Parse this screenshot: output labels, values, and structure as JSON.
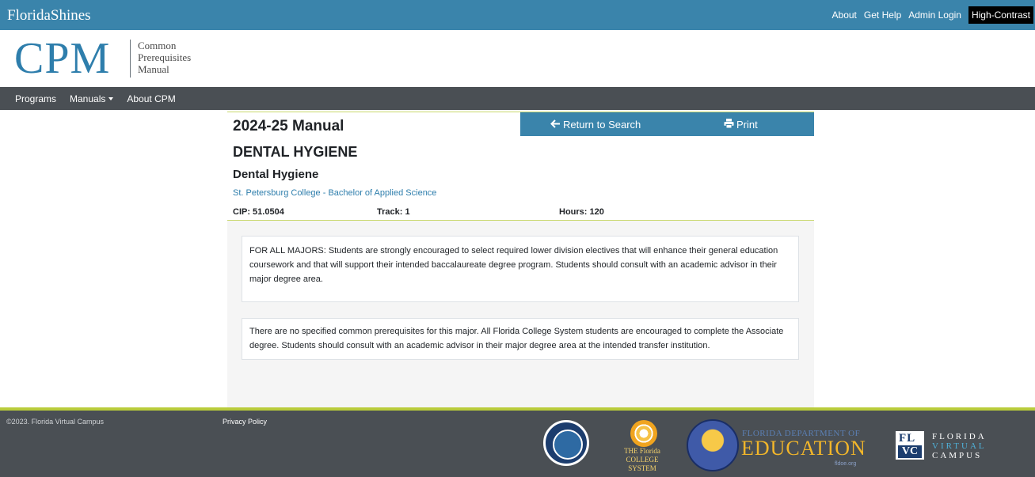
{
  "topbar": {
    "brand": "FloridaShines",
    "links": [
      "About",
      "Get Help",
      "Admin Login"
    ],
    "high_contrast": "High-Contrast"
  },
  "logo": {
    "acronym": "CPM",
    "line1": "Common",
    "line2": "Prerequisites",
    "line3": "Manual"
  },
  "nav": {
    "programs": "Programs",
    "manuals": "Manuals",
    "about": "About CPM"
  },
  "panel": {
    "manual_title": "2024-25 Manual",
    "return_label": "Return to Search",
    "print_label": "Print",
    "program_title": "DENTAL HYGIENE",
    "program_sub": "Dental Hygiene",
    "institution": "St. Petersburg College - Bachelor of Applied Science",
    "cip": "CIP: 51.0504",
    "track": "Track: 1",
    "hours": "Hours: 120",
    "note_majors": "FOR ALL MAJORS: Students are strongly encouraged to select required lower division electives that will enhance their general education coursework and that will support their intended baccalaureate degree program. Students should consult with an academic advisor in their major degree area.",
    "note_prereq": "There are no specified common prerequisites for this major. All Florida College System students are encouraged to complete the Associate degree. Students should consult with an academic advisor in their major degree area at the intended transfer institution."
  },
  "footer": {
    "copyright": "©2023. Florida Virtual Campus",
    "privacy": "Privacy Policy",
    "fcs_line1": "THE Florida",
    "fcs_line2": "COLLEGE SYSTEM",
    "fdoe_top": "FLORIDA DEPARTMENT OF",
    "fdoe_big": "EDUCATION",
    "fdoe_url": "fldoe.org",
    "flvc_fl": "FL",
    "flvc_vc": "VC",
    "flvc_line1": "FLORIDA",
    "flvc_line2": "VIRTUAL",
    "flvc_line3": "CAMPUS"
  },
  "colors": {
    "brand_blue": "#3a84ab",
    "nav_gray": "#4a4f54",
    "accent_green": "#b9cc3b"
  }
}
